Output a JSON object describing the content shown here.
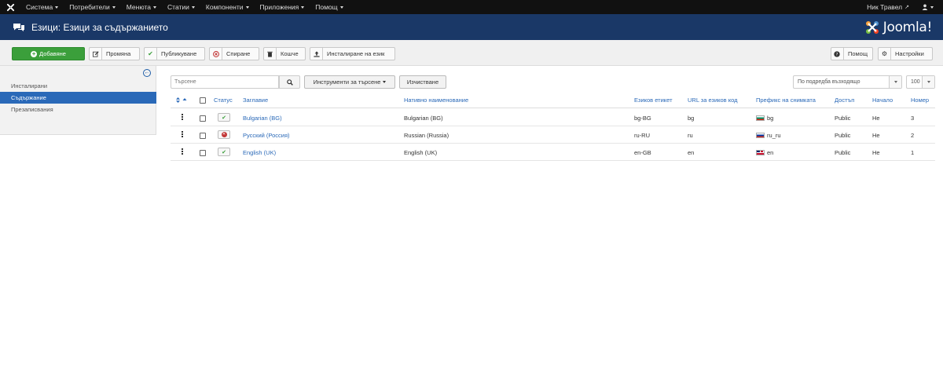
{
  "navbar": {
    "menu": [
      {
        "label": "Система"
      },
      {
        "label": "Потребители"
      },
      {
        "label": "Менюта"
      },
      {
        "label": "Статии"
      },
      {
        "label": "Компоненти"
      },
      {
        "label": "Приложения"
      },
      {
        "label": "Помощ"
      }
    ],
    "user_name": "Ник Травел"
  },
  "header": {
    "title": "Езици: Езици за съдържанието",
    "brand": "Joomla!"
  },
  "toolbar": {
    "new_label": "Добавяне",
    "edit_label": "Промяна",
    "publish_label": "Публикуване",
    "unpublish_label": "Спиране",
    "trash_label": "Кошче",
    "install_label": "Инсталиране на език",
    "help_label": "Помощ",
    "options_label": "Настройки"
  },
  "sidebar": {
    "items": [
      {
        "label": "Инсталирани"
      },
      {
        "label": "Съдържание",
        "active": true
      },
      {
        "label": "Презаписвания"
      }
    ]
  },
  "filters": {
    "search_placeholder": "Търсене",
    "search_tools_label": "Инструменти за търсене",
    "clear_label": "Изчистване",
    "ordering_value": "По подредба възходящо",
    "limit_value": "100"
  },
  "table": {
    "headers": {
      "status": "Статус",
      "title": "Заглавие",
      "native": "Нативно наименование",
      "tag": "Езиков етикет",
      "url": "URL за езиков код",
      "image": "Префикс на снимката",
      "access": "Достъп",
      "home": "Начало",
      "id": "Номер"
    },
    "rows": [
      {
        "status": "published",
        "title": "Bulgarian (BG)",
        "native": "Bulgarian (BG)",
        "tag": "bg-BG",
        "url": "bg",
        "image": "bg",
        "flag": "flag-bg",
        "access": "Public",
        "home": "Не",
        "id": "3"
      },
      {
        "status": "unpublished",
        "title": "Русский (Россия)",
        "native": "Russian (Russia)",
        "tag": "ru-RU",
        "url": "ru",
        "image": "ru_ru",
        "flag": "flag-ru",
        "access": "Public",
        "home": "Не",
        "id": "2"
      },
      {
        "status": "published",
        "title": "English (UK)",
        "native": "English (UK)",
        "tag": "en-GB",
        "url": "en",
        "image": "en",
        "flag": "flag-gb",
        "access": "Public",
        "home": "Не",
        "id": "1"
      }
    ]
  },
  "colors": {
    "header_bg": "#1a3867",
    "navbar_bg": "#111111",
    "accent": "#2a69b8",
    "success": "#3b9f3b",
    "danger": "#c23636"
  }
}
